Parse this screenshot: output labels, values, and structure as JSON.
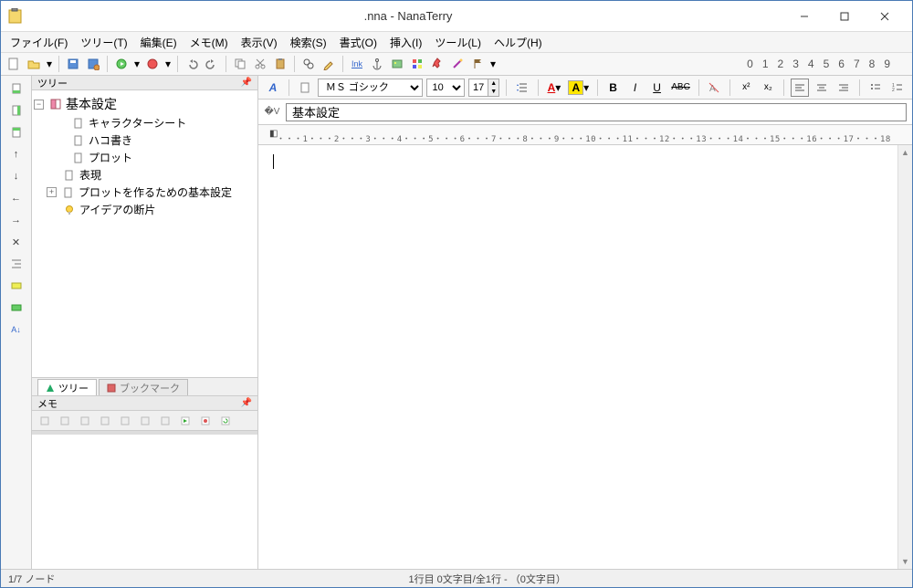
{
  "titlebar": {
    "title": ".nna - NanaTerry"
  },
  "menu": {
    "file": "ファイル(F)",
    "tree": "ツリー(T)",
    "edit": "編集(E)",
    "memo": "メモ(M)",
    "view": "表示(V)",
    "search": "検索(S)",
    "format": "書式(O)",
    "insert": "挿入(I)",
    "tool": "ツール(L)",
    "help": "ヘルプ(H)"
  },
  "numstrip": [
    "0",
    "1",
    "2",
    "3",
    "4",
    "5",
    "6",
    "7",
    "8",
    "9"
  ],
  "side": {
    "panel_title": "ツリー",
    "tabs": {
      "tree": "ツリー",
      "bookmark": "ブックマーク"
    },
    "memo_title": "メモ",
    "nodes": {
      "root": "基本設定",
      "char": "キャラクターシート",
      "box": "ハコ書き",
      "plot": "プロット",
      "expr": "表現",
      "plot_base": "プロットを作るための基本設定",
      "idea": "アイデアの断片"
    }
  },
  "editor": {
    "font": "ＭＳ ゴシック",
    "font_size": "10",
    "line_height": "17",
    "title_field": "基本設定",
    "ruler": "・・・1・・・2・・・3・・・4・・・5・・・6・・・7・・・8・・・9・・・10・・・11・・・12・・・13・・・14・・・15・・・16・・・17・・・18"
  },
  "status": {
    "left": "1/7 ノード",
    "center": "1行目 0文字目/全1行 -  （0文字目）"
  },
  "icons": {
    "ink": "Ink"
  }
}
